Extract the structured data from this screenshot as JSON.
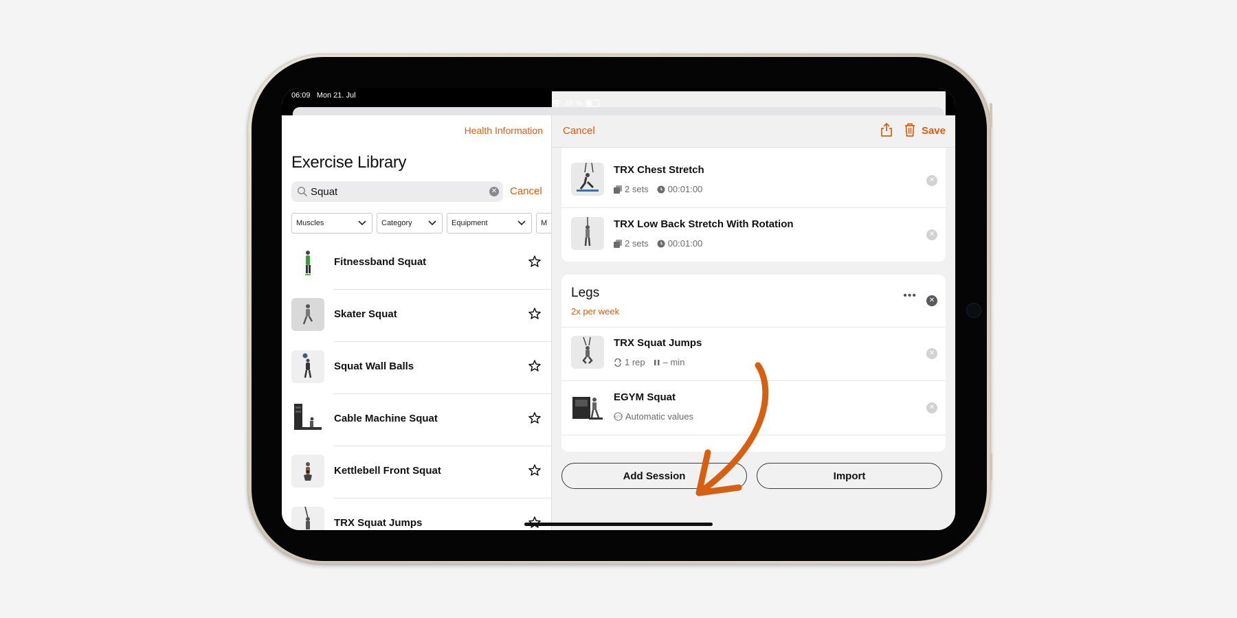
{
  "status_bar": {
    "time": "06:09",
    "date": "Mon 21. Jul",
    "battery": "45 %"
  },
  "left_panel": {
    "health_link": "Health Information",
    "title": "Exercise Library",
    "search": {
      "value": "Squat",
      "cancel": "Cancel"
    },
    "filters": [
      "Muscles",
      "Category",
      "Equipment",
      "M"
    ],
    "exercises": [
      {
        "name": "Fitnessband Squat"
      },
      {
        "name": "Skater Squat"
      },
      {
        "name": "Squat Wall Balls"
      },
      {
        "name": "Cable Machine Squat"
      },
      {
        "name": "Kettlebell Front Squat"
      },
      {
        "name": "TRX Squat Jumps"
      }
    ]
  },
  "right_panel": {
    "cancel": "Cancel",
    "save": "Save",
    "icons": [
      "share-icon",
      "trash-icon"
    ],
    "top_session_exercises": [
      {
        "name": "TRX Chest Stretch",
        "sets": "2 sets",
        "time": "00:01:00"
      },
      {
        "name": "TRX Low Back Stretch With Rotation",
        "sets": "2 sets",
        "time": "00:01:00"
      }
    ],
    "legs_session": {
      "title": "Legs",
      "frequency": "2x per week",
      "exercises": [
        {
          "name": "TRX Squat Jumps",
          "reps": "1 rep",
          "pause": "– min"
        },
        {
          "name": "EGYM Squat",
          "auto": "Automatic values"
        }
      ]
    },
    "buttons": {
      "add_session": "Add Session",
      "import": "Import"
    }
  },
  "colors": {
    "accent": "#d65f12",
    "annotation_arrow": "#d65f12"
  }
}
